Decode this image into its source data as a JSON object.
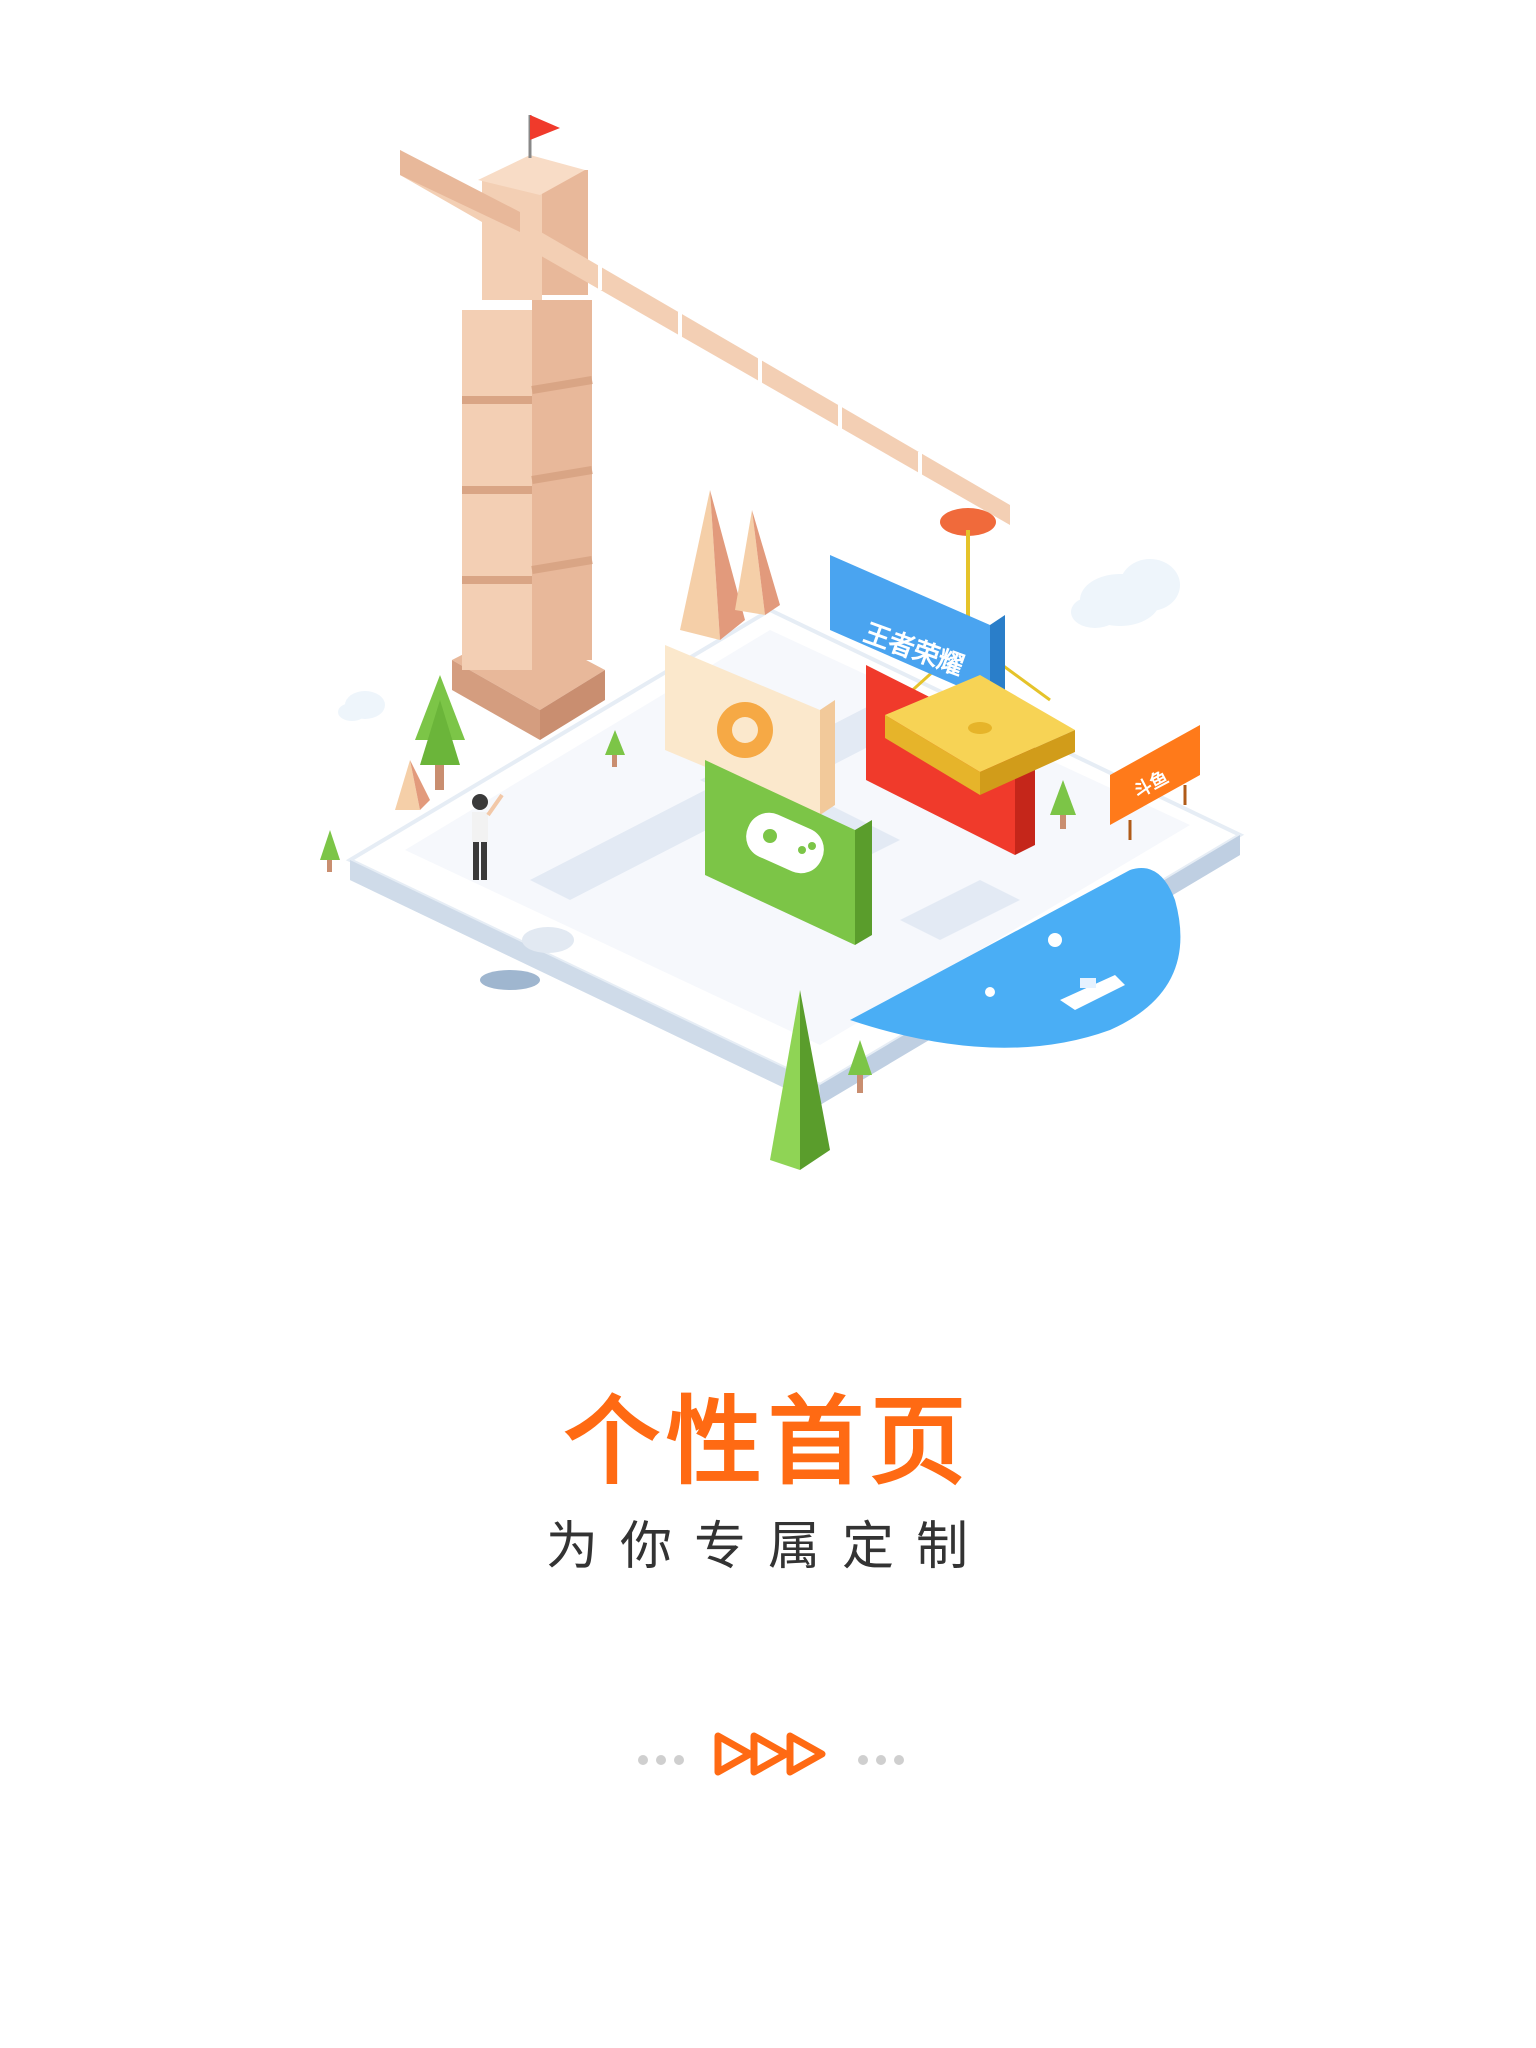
{
  "onboarding": {
    "title": "个性首页",
    "subtitle": "为你专属定制",
    "illustration": {
      "billboards": [
        "王者荣耀",
        "斗鱼"
      ]
    },
    "pager": {
      "left_dots": 3,
      "right_dots": 3,
      "active_icon": "triple-play-arrow-icon"
    }
  },
  "colors": {
    "accent": "#FF6A13",
    "subtitle_text": "#333333",
    "inactive_dot": "#CFCFCF"
  }
}
